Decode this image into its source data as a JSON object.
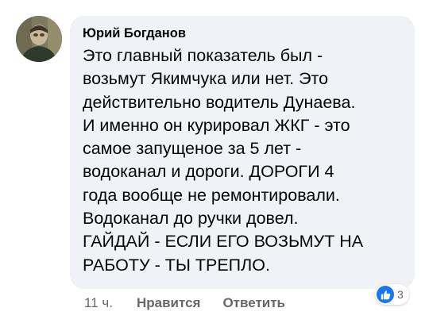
{
  "comment": {
    "author": "Юрий Богданов",
    "lines": [
      "Это главный показатель был -",
      "возьмут Якимчука или нет. Это",
      "действительно водитель Дунаева.",
      "И именно он курировал ЖКГ - это",
      "самое запущеное за 5 лет -",
      "водоканал и дороги. ДОРОГИ 4",
      "года вообще не ремонтировали.",
      "Водоканал до ручки довел.",
      "ГАЙДАЙ - ЕСЛИ ЕГО ВОЗЬМУТ НА",
      "РАБОТУ - ТЫ ТРЕПЛО."
    ]
  },
  "footer": {
    "timestamp": "11 ч.",
    "like_label": "Нравится",
    "reply_label": "Ответить"
  },
  "reactions": {
    "icon": "like-icon",
    "count": "3",
    "color": "#1877f2"
  },
  "colors": {
    "bubble_bg": "#f0f2f5",
    "secondary_text": "#65676b",
    "primary_text": "#050505"
  }
}
